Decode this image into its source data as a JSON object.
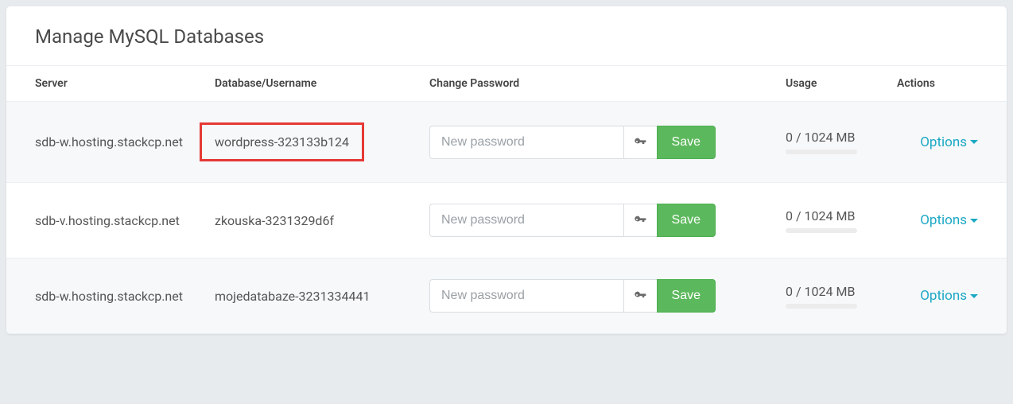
{
  "title": "Manage MySQL Databases",
  "headers": {
    "server": "Server",
    "database": "Database/Username",
    "password": "Change Password",
    "usage": "Usage",
    "actions": "Actions"
  },
  "password_placeholder": "New password",
  "save_label": "Save",
  "options_label": "Options",
  "rows": [
    {
      "server": "sdb-w.hosting.stackcp.net",
      "database": "wordpress-323133b124",
      "highlighted": true,
      "usage": "0 / 1024 MB"
    },
    {
      "server": "sdb-v.hosting.stackcp.net",
      "database": "zkouska-3231329d6f",
      "highlighted": false,
      "usage": "0 / 1024 MB"
    },
    {
      "server": "sdb-w.hosting.stackcp.net",
      "database": "mojedatabaze-3231334441",
      "highlighted": false,
      "usage": "0 / 1024 MB"
    }
  ]
}
